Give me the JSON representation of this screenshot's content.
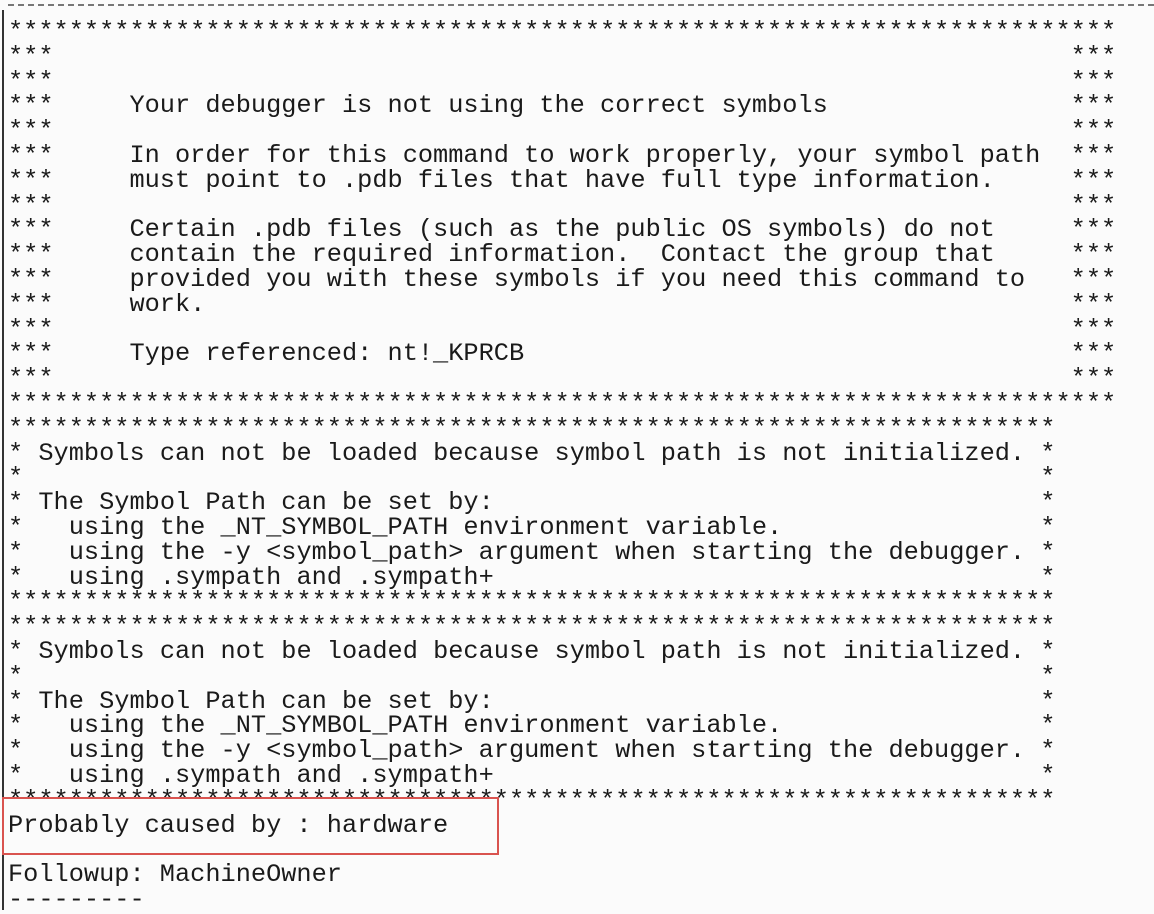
{
  "symbol_warning": {
    "lines": [
      {
        "l": "*************************************************************************",
        "t": "",
        "r": ""
      },
      {
        "l": "***",
        "t": "",
        "r": "***"
      },
      {
        "l": "***",
        "t": "",
        "r": "***"
      },
      {
        "l": "***",
        "t": "     Your debugger is not using the correct symbols",
        "r": "***"
      },
      {
        "l": "***",
        "t": "",
        "r": "***"
      },
      {
        "l": "***",
        "t": "     In order for this command to work properly, your symbol path",
        "r": "***"
      },
      {
        "l": "***",
        "t": "     must point to .pdb files that have full type information.",
        "r": "***"
      },
      {
        "l": "***",
        "t": "",
        "r": "***"
      },
      {
        "l": "***",
        "t": "     Certain .pdb files (such as the public OS symbols) do not",
        "r": "***"
      },
      {
        "l": "***",
        "t": "     contain the required information.  Contact the group that",
        "r": "***"
      },
      {
        "l": "***",
        "t": "     provided you with these symbols if you need this command to",
        "r": "***"
      },
      {
        "l": "***",
        "t": "     work.",
        "r": "***"
      },
      {
        "l": "***",
        "t": "",
        "r": "***"
      },
      {
        "l": "***",
        "t": "     Type referenced: nt!_KPRCB",
        "r": "***"
      },
      {
        "l": "***",
        "t": "",
        "r": "***"
      },
      {
        "l": "*************************************************************************",
        "t": "",
        "r": ""
      }
    ]
  },
  "symbol_path_blocks": [
    {
      "lines": [
        {
          "l": "*********************************************************************",
          "t": "",
          "r": ""
        },
        {
          "l": "*",
          "t": " Symbols can not be loaded because symbol path is not initialized.",
          "r": "*"
        },
        {
          "l": "*",
          "t": "",
          "r": "*"
        },
        {
          "l": "*",
          "t": " The Symbol Path can be set by:",
          "r": "*"
        },
        {
          "l": "*",
          "t": "   using the _NT_SYMBOL_PATH environment variable.",
          "r": "*"
        },
        {
          "l": "*",
          "t": "   using the -y <symbol_path> argument when starting the debugger.",
          "r": "*"
        },
        {
          "l": "*",
          "t": "   using .sympath and .sympath+",
          "r": "*"
        },
        {
          "l": "*********************************************************************",
          "t": "",
          "r": ""
        }
      ]
    },
    {
      "lines": [
        {
          "l": "*********************************************************************",
          "t": "",
          "r": ""
        },
        {
          "l": "*",
          "t": " Symbols can not be loaded because symbol path is not initialized.",
          "r": "*"
        },
        {
          "l": "*",
          "t": "",
          "r": "*"
        },
        {
          "l": "*",
          "t": " The Symbol Path can be set by:",
          "r": "*"
        },
        {
          "l": "*",
          "t": "   using the _NT_SYMBOL_PATH environment variable.",
          "r": "*"
        },
        {
          "l": "*",
          "t": "   using the -y <symbol_path> argument when starting the debugger.",
          "r": "*"
        },
        {
          "l": "*",
          "t": "   using .sympath and .sympath+",
          "r": "*"
        },
        {
          "l": "*********************************************************************",
          "t": "",
          "r": ""
        }
      ]
    }
  ],
  "analysis": {
    "probably_caused_by": "Probably caused by : hardware",
    "followup": "Followup: MachineOwner",
    "separator": "---------"
  },
  "highlight_color": "#d9534f"
}
